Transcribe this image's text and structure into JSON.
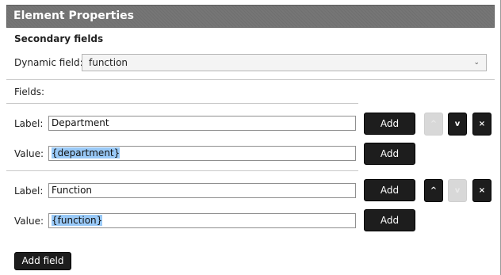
{
  "panel": {
    "title": "Element Properties",
    "section_title": "Secondary fields",
    "dynamic_field_label": "Dynamic field:",
    "dynamic_field_value": "function",
    "fields_label": "Fields:"
  },
  "field_rows": [
    {
      "label_caption": "Label:",
      "label_value": "Department",
      "value_caption": "Value:",
      "value_value": "{department}",
      "add_label_btn": "Add",
      "add_value_btn": "Add",
      "up_glyph": "^",
      "down_glyph": "v",
      "remove_glyph": "×",
      "up_enabled": false,
      "down_enabled": true
    },
    {
      "label_caption": "Label:",
      "label_value": "Function",
      "value_caption": "Value:",
      "value_value": "{function}",
      "add_label_btn": "Add",
      "add_value_btn": "Add",
      "up_glyph": "^",
      "down_glyph": "v",
      "remove_glyph": "×",
      "up_enabled": true,
      "down_enabled": false
    }
  ],
  "add_field_button": "Add field",
  "icons": {
    "dropdown": "chevron-down-icon",
    "up": "arrow-up-icon",
    "down": "arrow-down-icon",
    "remove": "close-icon"
  },
  "colors": {
    "titlebar": "#737373",
    "button": "#1d1d1d",
    "button_disabled": "#d8d8d8",
    "selection": "#99c9f7"
  }
}
